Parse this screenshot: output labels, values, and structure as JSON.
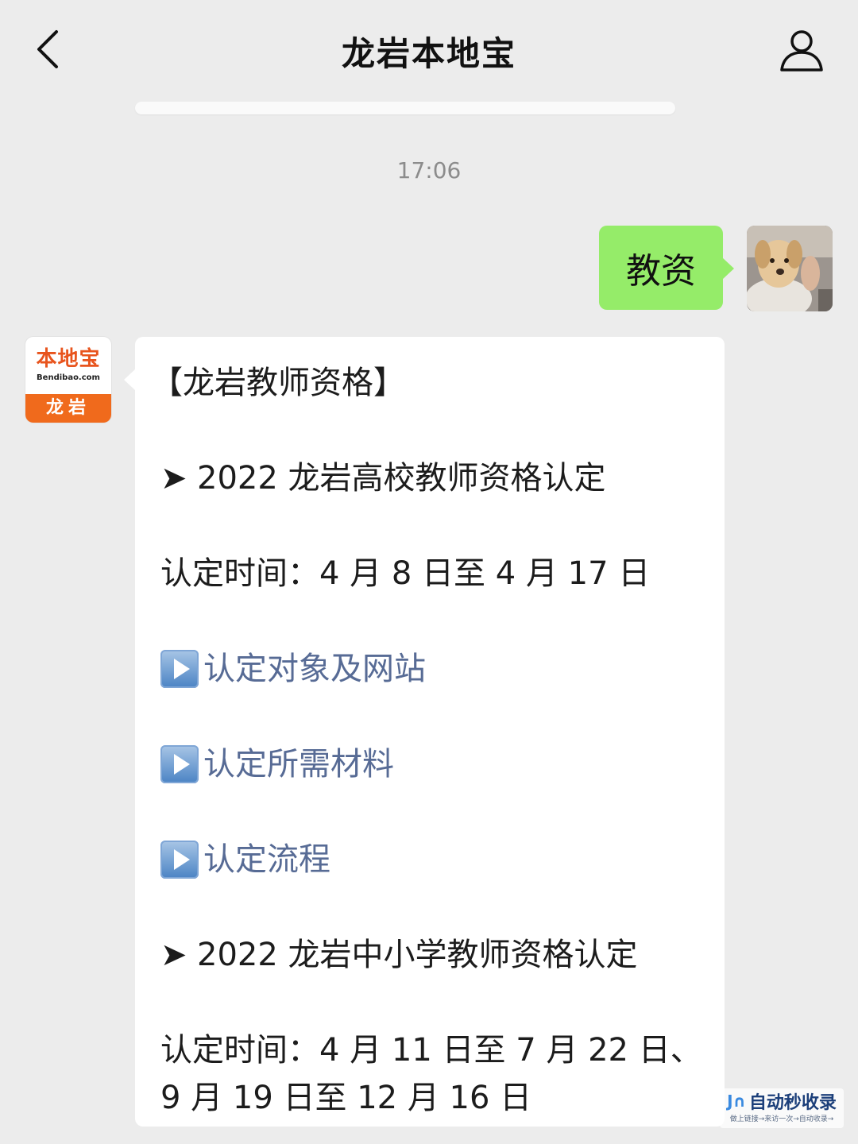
{
  "header": {
    "title": "龙岩本地宝",
    "back_icon": "chevron-left-icon",
    "profile_icon": "person-icon"
  },
  "timestamp": "17:06",
  "outgoing": {
    "text": "教资",
    "bubble_color": "#95ec69"
  },
  "bot_avatar": {
    "brand": "本地宝",
    "domain": "Bendibao.com",
    "city": "龙岩",
    "accent_color": "#f06a1c"
  },
  "incoming": {
    "heading": "【龙岩教师资格】",
    "section1": {
      "arrow": "➤",
      "title": "2022 龙岩高校教师资格认定",
      "time": "认定时间：4 月 8 日至 4 月 17 日",
      "links": [
        "认定对象及网站",
        "认定所需材料",
        "认定流程"
      ]
    },
    "section2": {
      "arrow": "➤",
      "title": "2022 龙岩中小学教师资格认定",
      "time_line1": "认定时间：4 月 11 日至 7 月 22 日、",
      "time_line2": "9 月 19 日至 12 月 16 日"
    },
    "link_color": "#576b95"
  },
  "watermark": {
    "logo": "J∩",
    "name": "自动秒收录",
    "tagline": "做上链接→来访一次→自动收录→"
  }
}
